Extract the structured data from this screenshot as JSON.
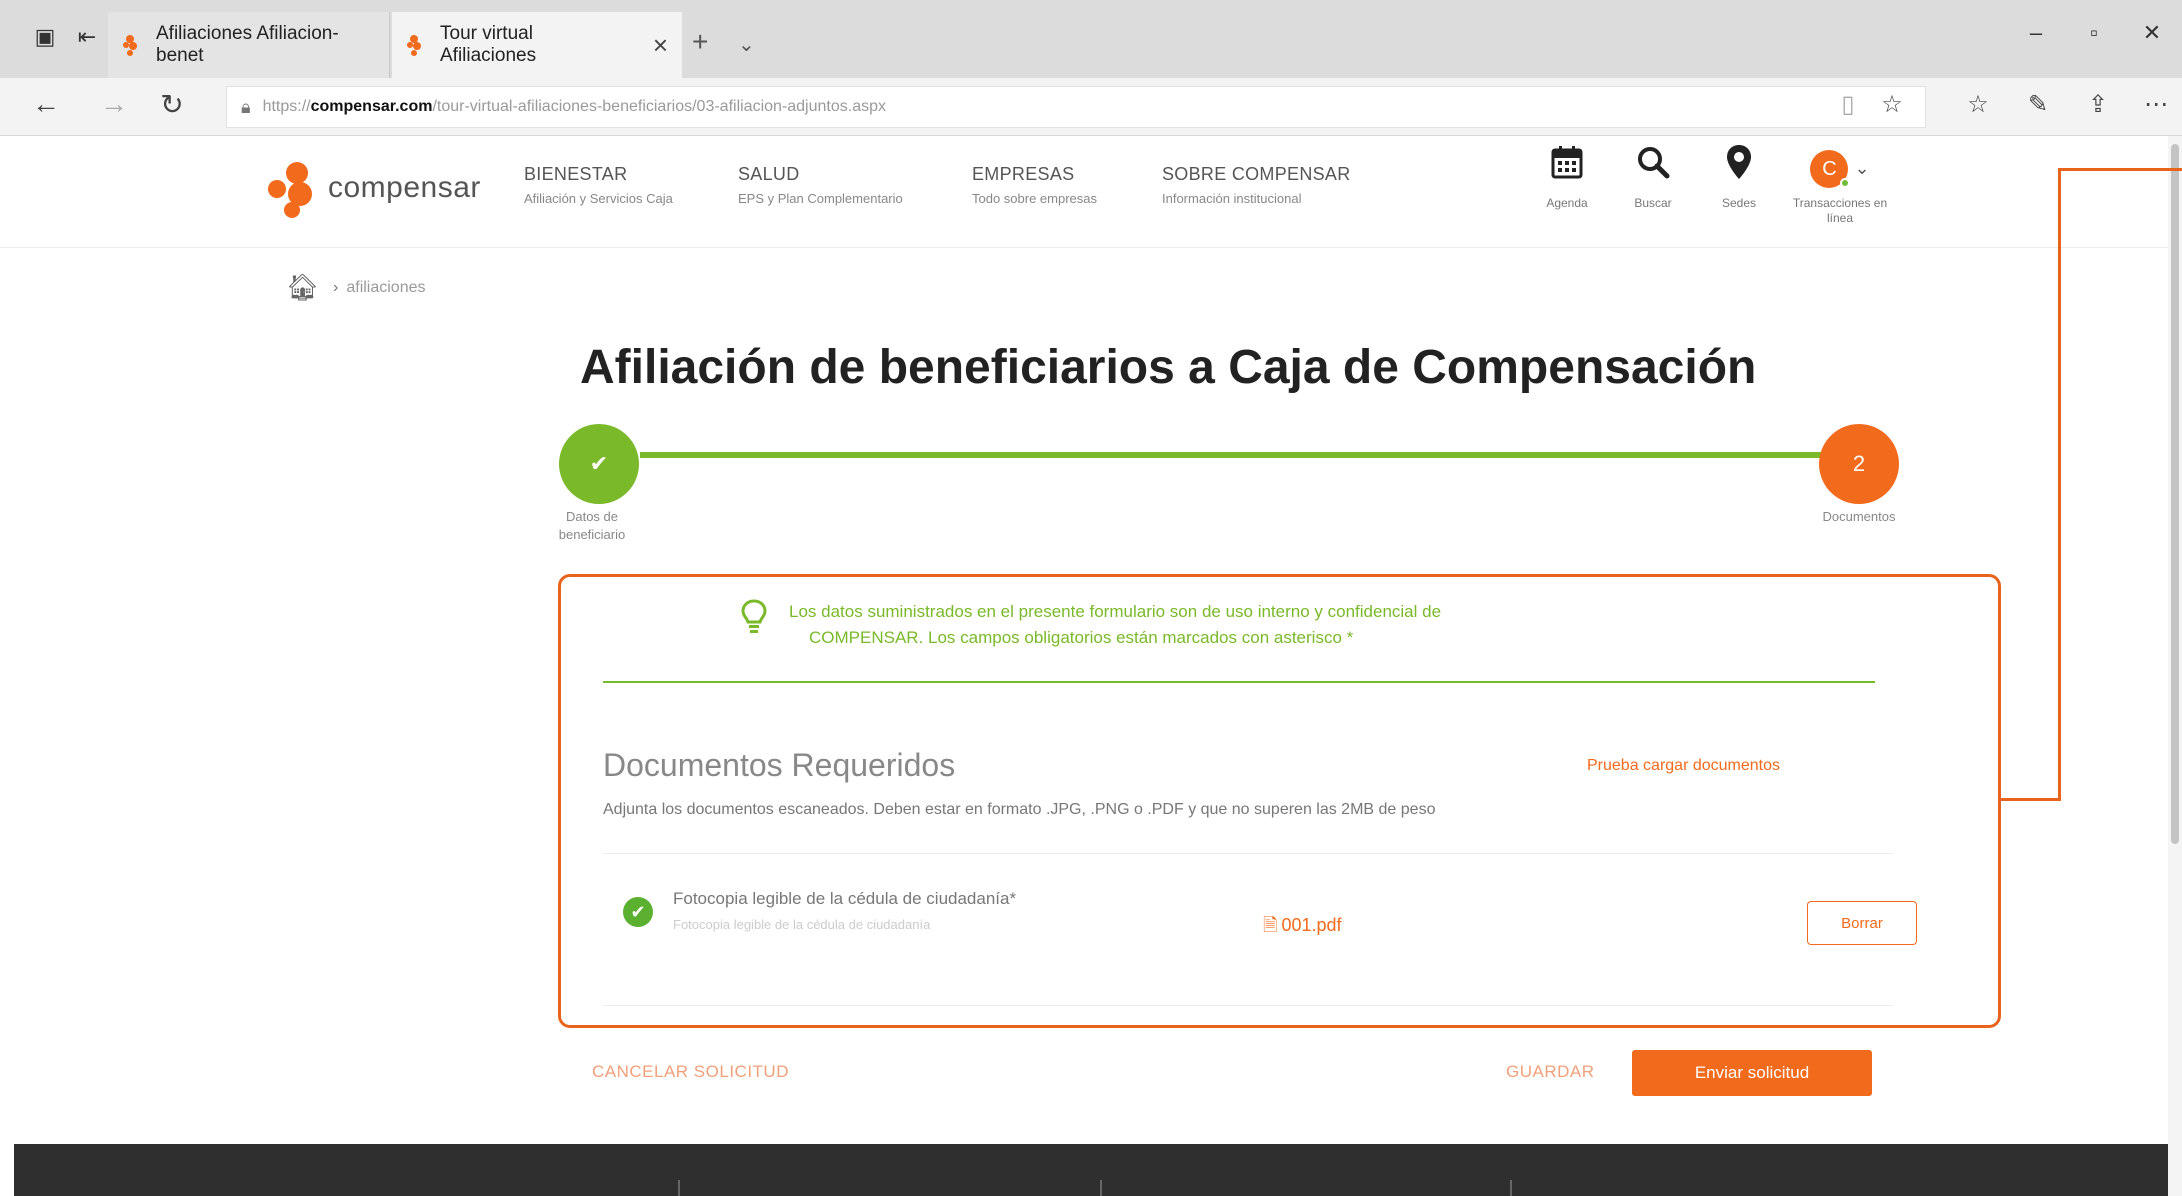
{
  "browser": {
    "tabs": [
      {
        "title": "Afiliaciones Afiliacion-benet",
        "active": false
      },
      {
        "title": "Tour virtual Afiliaciones",
        "active": true
      }
    ],
    "url_prefix": "https://",
    "url_host": "compensar.com",
    "url_path": "/tour-virtual-afiliaciones-beneficiarios/03-afiliacion-adjuntos.aspx"
  },
  "header": {
    "logo_text": "compensar",
    "menu": [
      {
        "title": "BIENESTAR",
        "subtitle": "Afiliación y Servicios Caja"
      },
      {
        "title": "SALUD",
        "subtitle": "EPS y Plan Complementario"
      },
      {
        "title": "EMPRESAS",
        "subtitle": "Todo sobre empresas"
      },
      {
        "title": "SOBRE COMPENSAR",
        "subtitle": "Información institucional"
      }
    ],
    "utilities": [
      {
        "label": "Agenda",
        "icon": "calendar-icon"
      },
      {
        "label": "Buscar",
        "icon": "search-icon"
      },
      {
        "label": "Sedes",
        "icon": "location-pin-icon"
      }
    ],
    "user_initial": "C",
    "transactions_label": "Transacciones en línea"
  },
  "breadcrumb": {
    "current": "afiliaciones"
  },
  "page": {
    "title": "Afiliación de beneficiarios a Caja de Compensación"
  },
  "stepper": {
    "steps": [
      {
        "label": "Datos de beneficiario",
        "status": "complete",
        "symbol": "✔"
      },
      {
        "label": "Documentos",
        "status": "current",
        "symbol": "2"
      }
    ]
  },
  "form": {
    "notice": "Los datos suministrados en el presente formulario son de uso interno y confidencial de COMPENSAR. Los campos obligatorios están marcados con asterisco *",
    "notice_line1": "Los datos suministrados en el presente formulario son de uso interno y confidencial de",
    "notice_line2": "COMPENSAR. Los campos obligatorios están marcados con asterisco *",
    "docs_title": "Documentos Requeridos",
    "try_link": "Prueba cargar documentos",
    "docs_desc": "Adjunta los documentos escaneados. Deben estar en formato .JPG, .PNG o .PDF y que no superen las 2MB de peso",
    "documents": [
      {
        "name": "Fotocopia legible de la cédula de ciudadanía*",
        "subtitle": "Fotocopia legible de la cédula de ciudadanía",
        "file": "001.pdf",
        "delete_label": "Borrar"
      }
    ]
  },
  "actions": {
    "cancel": "CANCELAR SOLICITUD",
    "save": "GUARDAR",
    "submit": "Enviar solicitud"
  },
  "colors": {
    "brand_orange": "#f26a1b",
    "brand_green": "#7ab929"
  }
}
